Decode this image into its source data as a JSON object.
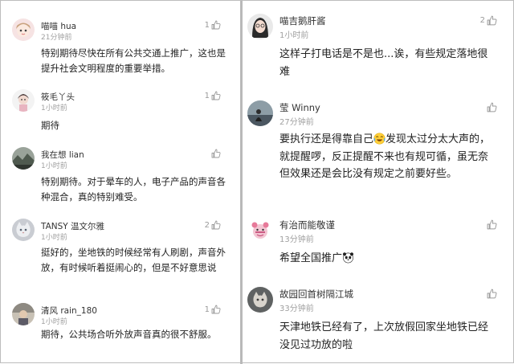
{
  "left_comments": [
    {
      "name": "喵喵 hua",
      "time": "21分钟前",
      "likes": "1",
      "text": "特别期待尽快在所有公共交通上推广，这也是提升社会文明程度的重要举措。",
      "avatar": "girl-avatar"
    },
    {
      "name": "筱毛丫头",
      "time": "1小时前",
      "likes": "1",
      "text": "期待",
      "avatar": "girl-avatar"
    },
    {
      "name": "我在想 lian",
      "time": "1小时前",
      "likes": "",
      "text": "特别期待。对于晕车的人，电子产品的声音各种混合，真的特别难受。",
      "avatar": "scenery-avatar"
    },
    {
      "name": "TANSY 温文尔雅",
      "time": "1小时前",
      "likes": "2",
      "text": "挺好的，坐地铁的时候经常有人刷剧，声音外放，有时候听着挺闹心的，但是不好意思说",
      "avatar": "cat-avatar"
    },
    {
      "name": "清风 rain_180",
      "time": "1小时前",
      "likes": "1",
      "text": "期待，公共场合听外放声音真的很不舒服。",
      "avatar": "photo-avatar"
    }
  ],
  "right_comments": [
    {
      "name": "喵吉鹅肝酱",
      "time": "1小时前",
      "likes": "2",
      "text": "这样子打电话是不是也...诶，有些规定落地很难",
      "avatar": "girl-avatar"
    },
    {
      "name": "莹 Winny",
      "time": "27分钟前",
      "likes": "",
      "text_before": "要执行还是得靠自己",
      "emoji_1": "laughing-emoji",
      "text_after": "发现太过分太大声的，就提醒啰，反正提醒不来也有规可循，虽无奈但效果还是会比没有规定之前要好些。",
      "avatar": "scenery-avatar"
    },
    {
      "name": "有治而能敬谨",
      "time": "13分钟前",
      "likes": "",
      "text_before": "希望全国推广",
      "emoji_1": "panda-emoji",
      "avatar": "cartoon-avatar"
    },
    {
      "name": "故园回首树隔江城",
      "time": "33分钟前",
      "likes": "",
      "text": "天津地铁已经有了，上次放假回家坐地铁已经没见过功放的啦",
      "avatar": "cat-avatar"
    }
  ],
  "icons": {
    "like": "thumbs-up-icon"
  },
  "colors": {
    "divider": "#b9b9b9",
    "timestamp": "#a0a0a0",
    "text": "#222222"
  }
}
